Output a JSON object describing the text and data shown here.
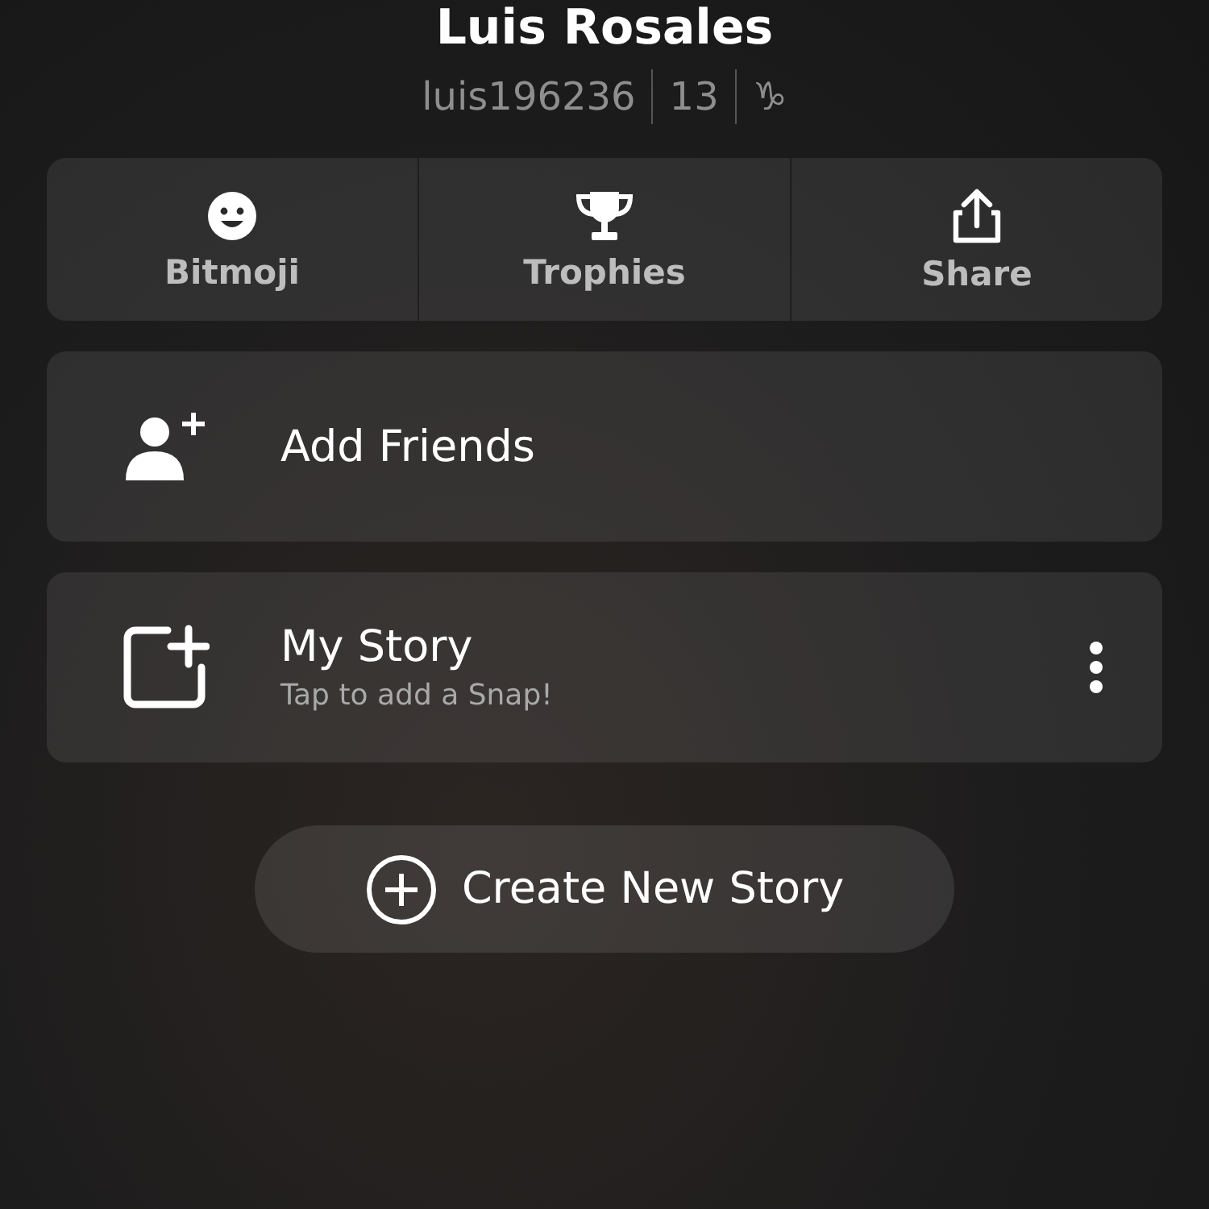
{
  "profile": {
    "name": "Luis Rosales",
    "username": "luis196236",
    "score": "13",
    "zodiac": "♑"
  },
  "actions": [
    {
      "label": "Bitmoji",
      "kind": "bitmoji"
    },
    {
      "label": "Trophies",
      "kind": "trophy"
    },
    {
      "label": "Share",
      "kind": "share"
    }
  ],
  "add_friends": {
    "label": "Add Friends"
  },
  "my_story": {
    "title": "My Story",
    "subtitle": "Tap to add a Snap!"
  },
  "create_button": {
    "label": "Create New Story"
  }
}
